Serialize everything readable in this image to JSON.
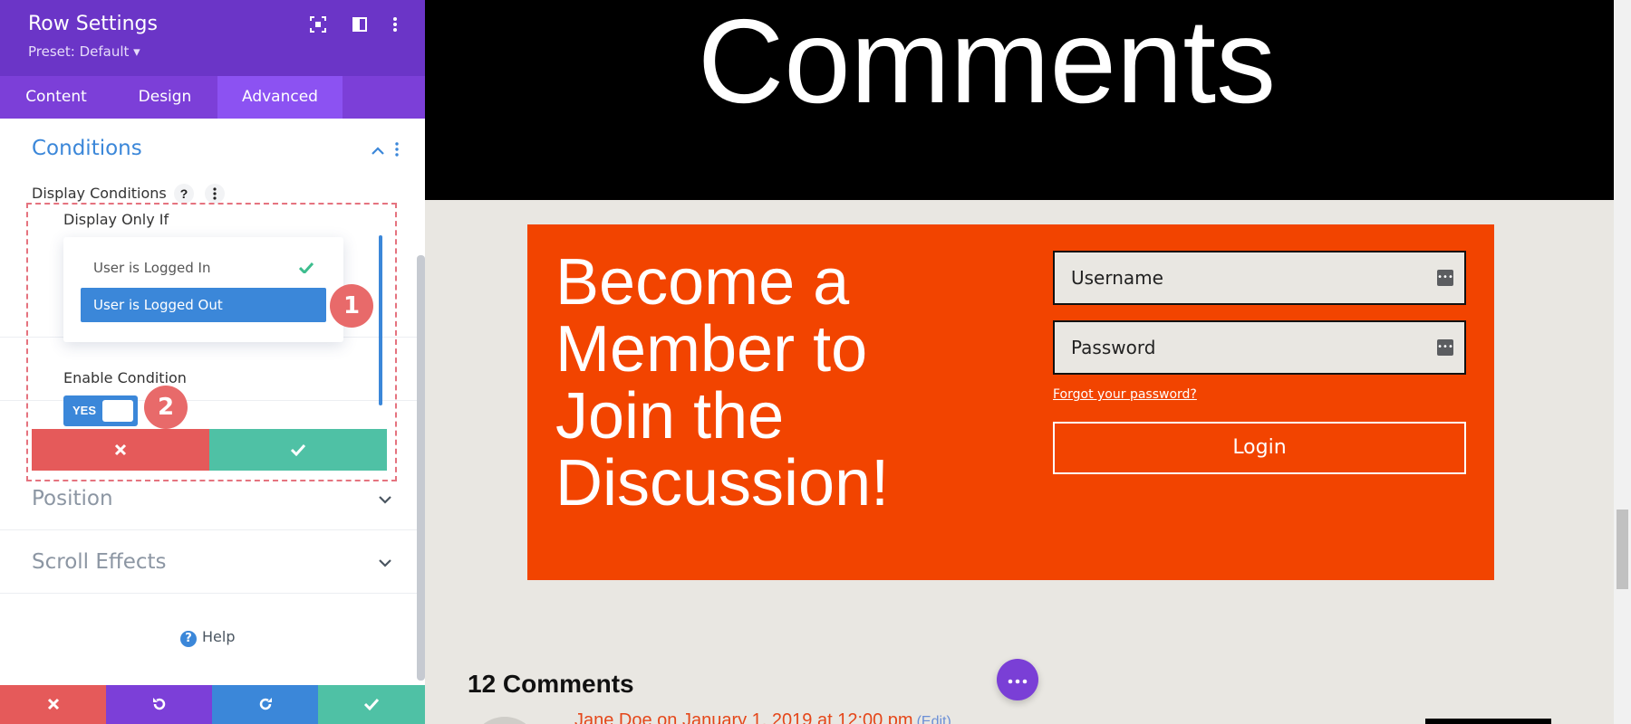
{
  "panel": {
    "title": "Row Settings",
    "preset": "Preset: Default ▾",
    "header_icons": [
      "focus-icon",
      "sidebar-layout-icon",
      "more-vertical-icon"
    ],
    "tabs": [
      {
        "label": "Content",
        "active": false
      },
      {
        "label": "Design",
        "active": false
      },
      {
        "label": "Advanced",
        "active": true
      }
    ],
    "conditions": {
      "title": "Conditions",
      "display_conditions_label": "Display Conditions",
      "help_glyph": "?",
      "display_only_if_label": "Display Only If",
      "options": [
        {
          "label": "User is Logged In",
          "checked": true,
          "selected": false
        },
        {
          "label": "User is Logged Out",
          "checked": false,
          "selected": true
        }
      ],
      "enable_condition_label": "Enable Condition",
      "toggle_label": "YES",
      "toggle_on": true
    },
    "badges": [
      "1",
      "2"
    ],
    "sections": [
      {
        "label": "Position"
      },
      {
        "label": "Scroll Effects"
      }
    ],
    "help_label": "Help",
    "colors": {
      "header": "#6b35c7",
      "tab_bar": "#7c3fd8",
      "tab_active": "#8c52f2",
      "accent_blue": "#3b87d9",
      "cancel_red": "#e55a5a",
      "confirm_green": "#4fc1a5",
      "badge_red": "#e86a6a"
    }
  },
  "preview": {
    "hero_title": "Comments",
    "cta_heading": "Become a Member to Join the Discussion!",
    "username_placeholder": "Username",
    "password_placeholder": "Password",
    "forgot_link": "Forgot your password?",
    "login_label": "Login",
    "comments_count": "12 Comments",
    "comment_meta": "Jane Doe on January 1, 2019 at 12:00 pm",
    "comment_edit": "(Edit)",
    "colors": {
      "hero_bg": "#000000",
      "cta_bg": "#f24400",
      "page_bg": "#e9e7e2",
      "fab": "#7a3fd6"
    }
  }
}
